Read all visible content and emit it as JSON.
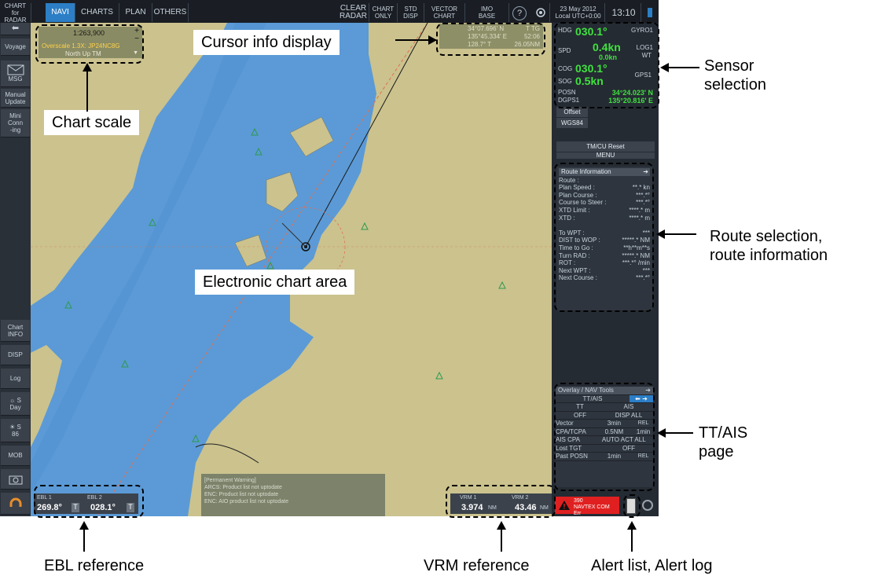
{
  "top_bar": {
    "chart_for_radar": [
      "CHART",
      "for RADAR"
    ],
    "tabs": [
      "NAVI",
      "CHARTS",
      "PLAN",
      "OTHERS"
    ],
    "clear_radar": [
      "CLEAR",
      "RADAR"
    ],
    "chart_only": [
      "CHART",
      "ONLY"
    ],
    "std_disp": [
      "STD",
      "DISP"
    ],
    "vector_chart": [
      "VECTOR",
      "CHART"
    ],
    "imo_base": [
      "IMO",
      "BASE"
    ],
    "help": "?",
    "date": "23 May 2012",
    "local_utc": "Local UTC+0:00",
    "time": "13:10"
  },
  "left_bar": {
    "back": "⬅",
    "voyage": "Voyage",
    "msg": "MSG",
    "manual_update": [
      "Manual",
      "Update"
    ],
    "mini_conning": [
      "Mini",
      "Conn",
      "-ing"
    ],
    "chart_info": [
      "Chart",
      "INFO"
    ],
    "disp": "DISP",
    "log": "Log",
    "day": [
      "S",
      "Day"
    ],
    "brill": [
      "S",
      "86"
    ],
    "mob": "MOB"
  },
  "chart_scale": {
    "scale": "1:263,900",
    "plus": "+",
    "minus": "−",
    "overscale": "Overscale 1.3X: JP24NC8G",
    "orientation": "North Up TM"
  },
  "cursor_info": {
    "lat": "34°07.696' N",
    "ttg": "T TG",
    "lon": "135°45.334' E",
    "ttg_val": "52:06",
    "brg": "128.7° T",
    "range": "26.05NM"
  },
  "sensor": {
    "hdg_label": "HDG",
    "hdg": "030.1°",
    "gyro": "GYRO1",
    "spd_label": "SPD",
    "spd": "0.4kn",
    "spd_sub": "0.0kn",
    "log": [
      "LOG1",
      "WT"
    ],
    "cog_label": "COG",
    "cog": "030.1°",
    "sog_label": "SOG",
    "sog": "0.5kn",
    "gps": "GPS1",
    "posn_label": "POSN",
    "lat": "34°24.023' N",
    "dgps_label": "DGPS1",
    "lon": "135°20.816' E",
    "offset": "Offset",
    "datum": "WGS84",
    "tm_reset": "TM/CU Reset",
    "menu": "MENU"
  },
  "route_info": {
    "title": "Route Information",
    "rows": [
      {
        "label": "Route :",
        "value": ""
      },
      {
        "label": "Plan Speed :",
        "value": "**.* kn"
      },
      {
        "label": "Plan Course :",
        "value": "***.*°"
      },
      {
        "label": "Course to Steer :",
        "value": "***.*°"
      },
      {
        "label": "XTD Limit :",
        "value": "****.* m"
      },
      {
        "label": "XTD :",
        "value": "****.* m"
      },
      {
        "label": "",
        "value": ""
      },
      {
        "label": "To WPT :",
        "value": "***"
      },
      {
        "label": "DIST to WOP :",
        "value": "*****.* NM"
      },
      {
        "label": "Time to Go :",
        "value": "**h**m**s"
      },
      {
        "label": "Turn RAD :",
        "value": "*****.* NM"
      },
      {
        "label": "ROT :",
        "value": "***.*° /min"
      },
      {
        "label": "Next WPT :",
        "value": "***"
      },
      {
        "label": "Next Course :",
        "value": "***.*°"
      }
    ]
  },
  "ttais": {
    "title": "Overlay / NAV Tools",
    "tab": "TT/AIS",
    "rows": [
      [
        "TT",
        "AIS"
      ],
      [
        "OFF",
        "DISP ALL"
      ],
      [
        "Vector",
        "3min",
        "REL"
      ],
      [
        "CPA/TCPA",
        "0.5NM",
        "1min"
      ],
      [
        "AIS CPA",
        "AUTO ACT ALL"
      ],
      [
        "Lost TGT",
        "OFF"
      ],
      [
        "Past POSN",
        "1min",
        "REL"
      ]
    ]
  },
  "ebl": {
    "ebl1_label": "EBL 1",
    "ebl1_value": "269.8°",
    "ebl2_label": "EBL 2",
    "ebl2_value": "028.1°",
    "t": "T"
  },
  "vrm": {
    "vrm1_label": "VRM 1",
    "vrm1_value": "3.974",
    "vrm2_label": "VRM 2",
    "vrm2_value": "43.46",
    "unit": "NM"
  },
  "warning": {
    "lines": [
      "[Permanent Warning]",
      "ARCS: Product list not uptodate",
      "ENC: Product list not uptodate",
      "ENC: AIO product list not uptodate"
    ]
  },
  "alert": {
    "code": "390",
    "text": "NAVTEX COM Err"
  },
  "callouts": {
    "cursor_info": "Cursor info display",
    "chart_scale": "Chart scale",
    "sensor_selection": [
      "Sensor",
      "selection"
    ],
    "chart_area": "Electronic chart area",
    "route_selection": [
      "Route selection,",
      "route information"
    ],
    "ttais_page": [
      "TT/AIS",
      "page"
    ],
    "ebl_reference": "EBL reference",
    "vrm_reference": "VRM reference",
    "alert_list": "Alert list, Alert log"
  },
  "colors": {
    "land": "#cbc28e",
    "water": "#5b9ad6",
    "deep_water": "#3c82c8",
    "route_line": "#e07050",
    "panel": "#252b33",
    "highlight": "#2c7ec6",
    "sensor_green": "#3fe23f",
    "alert_red": "#e02020"
  }
}
